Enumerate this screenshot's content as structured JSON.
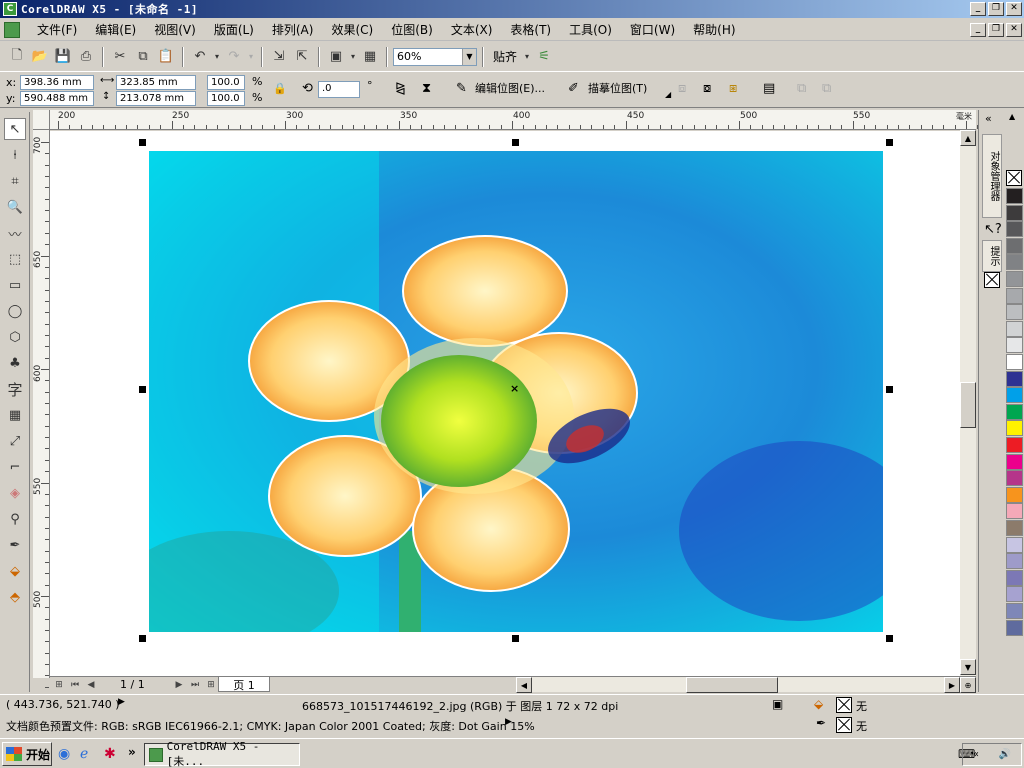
{
  "window": {
    "title": "CorelDRAW X5 - [未命名 -1]",
    "controls": [
      "_",
      "❐",
      "✕"
    ]
  },
  "menu": {
    "items": [
      "文件(F)",
      "编辑(E)",
      "视图(V)",
      "版面(L)",
      "排列(A)",
      "效果(C)",
      "位图(B)",
      "文本(X)",
      "表格(T)",
      "工具(O)",
      "窗口(W)",
      "帮助(H)"
    ]
  },
  "toolbar": {
    "zoom": "60%",
    "snap_label": "贴齐"
  },
  "property_bar": {
    "x_label": "x:",
    "x_value": "398.36 mm",
    "y_label": "y:",
    "y_value": "590.488 mm",
    "width_value": "323.85 mm",
    "height_value": "213.078 mm",
    "scale_x": "100.0",
    "scale_y": "100.0",
    "percent": "%",
    "rotation": ".0",
    "degree": "°",
    "edit_bitmap_label": "编辑位图(E)...",
    "trace_bitmap_label": "描摹位图(T)"
  },
  "rulers": {
    "horizontal": [
      "200",
      "250",
      "300",
      "350",
      "400",
      "450",
      "500",
      "550"
    ],
    "vertical": [
      "700",
      "650",
      "600",
      "550",
      "500"
    ],
    "unit": "毫米"
  },
  "page_nav": {
    "counter": "1 / 1",
    "tab": "页 1"
  },
  "docker": {
    "tab_object_manager": "对象管理器",
    "tab_hints": "提示"
  },
  "palette": {
    "colors": [
      "#231f20",
      "#3d3b3c",
      "#58585a",
      "#6d6e70",
      "#808285",
      "#939598",
      "#a7a9ac",
      "#bcbec0",
      "#d1d3d4",
      "#e6e7e8",
      "#ffffff",
      "#2e3192",
      "#00a0e9",
      "#00a650",
      "#fff200",
      "#ed1c24",
      "#ec008c",
      "#b5358a",
      "#f7941d",
      "#f5a9b8",
      "#8c7b6b",
      "#c7c5e3",
      "#9e9bc9",
      "#7c78b5",
      "#a6a2d0",
      "#7e87b8",
      "#5f6b9e"
    ]
  },
  "status": {
    "coords": "( 443.736, 521.740 )",
    "object_info": "668573_101517446192_2.jpg (RGB) 于 图层 1 72 x 72 dpi",
    "color_profile": "文档颜色预置文件: RGB: sRGB IEC61966-2.1; CMYK: Japan Color 2001 Coated; 灰度: Dot Gain 15%",
    "fill_none": "无",
    "outline_none": "无"
  },
  "taskbar": {
    "start": "开始",
    "task_label": "CorelDRAW X5 - [未..."
  }
}
